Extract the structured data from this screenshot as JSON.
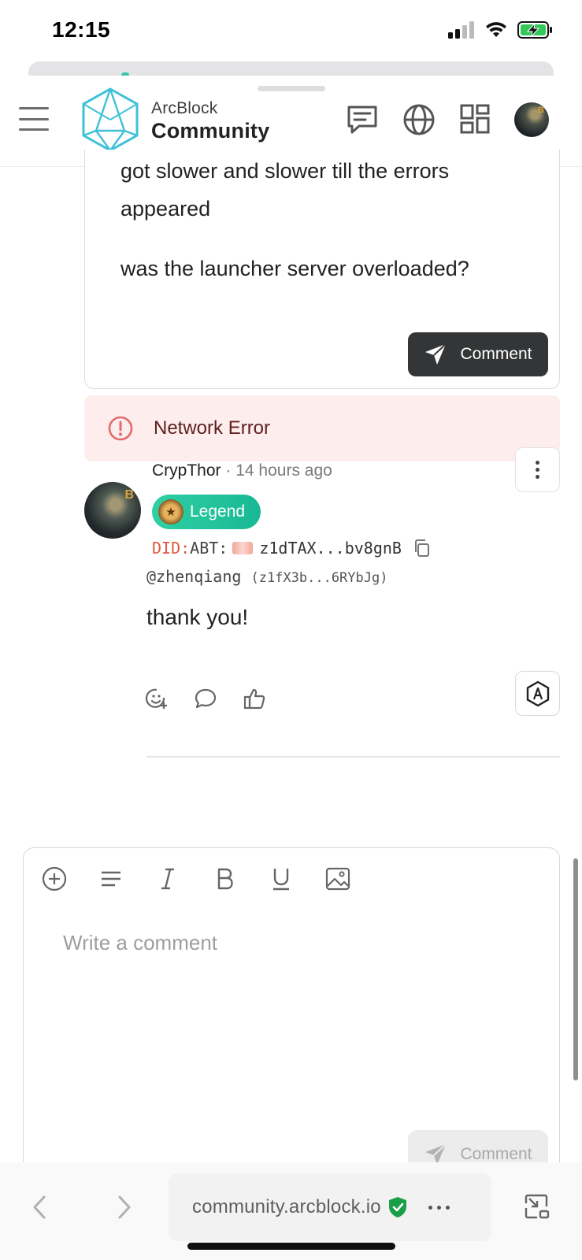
{
  "status_bar": {
    "time": "12:15"
  },
  "header": {
    "brand_top": "ArcBlock",
    "brand_bottom": "Community"
  },
  "previous_comment": {
    "lines": [
      "got slower and slower till the errors",
      "appeared",
      "was the launcher server overloaded?"
    ],
    "submit_label": "Comment"
  },
  "error": {
    "message": "Network Error"
  },
  "comment": {
    "author": "CrypThor",
    "separator": "·",
    "time_ago": "14 hours ago",
    "badge": "Legend",
    "did_prefix": "DID:",
    "did_type": "ABT:",
    "did_short": "z1dTAX...bv8gnB",
    "handle": "@zhenqiang",
    "handle_did": "(z1fX3b...6RYbJg)",
    "body": "thank you!"
  },
  "editor": {
    "placeholder": "Write a comment",
    "submit_label": "Comment"
  },
  "browser": {
    "url": "community.arcblock.io"
  },
  "colors": {
    "accent_green": "#19b895",
    "error_bg": "#fdeded",
    "error_text": "#5f2120",
    "did_prefix": "#e0583f",
    "button_dark": "#333536"
  }
}
